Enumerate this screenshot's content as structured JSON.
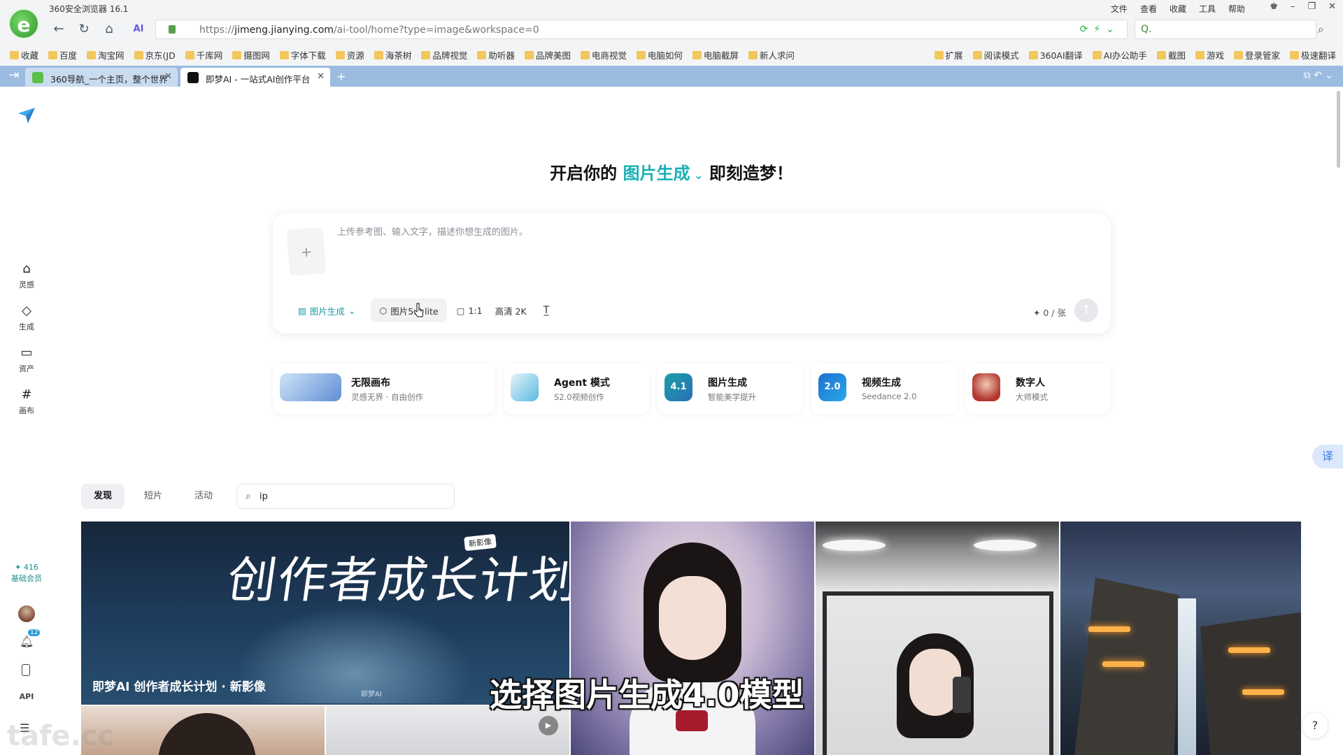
{
  "browser": {
    "window_title": "360安全浏览器 16.1",
    "menu": [
      "文件",
      "查看",
      "收藏",
      "工具",
      "帮助"
    ],
    "url_prefix": "https://",
    "url_host": "jimeng.jianying.com",
    "url_path": "/ai-tool/home?type=image&workspace=0",
    "search_value": "Q.",
    "bookmarks_left": [
      "收藏",
      "百度",
      "淘宝网",
      "京东(JD",
      "千库网",
      "摄图网",
      "字体下载",
      "资源",
      "海茶树",
      "品牌视觉",
      "助听器",
      "品牌美图",
      "电商视觉",
      "电脑如何",
      "电脑截屏",
      "新人求问"
    ],
    "bookmarks_right": [
      "扩展",
      "阅读模式",
      "360AI翻译",
      "AI办公助手",
      "截图",
      "游戏",
      "登录管家",
      "极速翻译"
    ],
    "tabs": [
      {
        "label": "360导航_一个主页，整个世界"
      },
      {
        "label": "即梦AI - 一站式AI创作平台"
      }
    ]
  },
  "rail": {
    "items": [
      {
        "label": "灵感",
        "icon": "home-icon"
      },
      {
        "label": "生成",
        "icon": "generate-icon"
      },
      {
        "label": "资产",
        "icon": "folder-icon"
      },
      {
        "label": "画布",
        "icon": "canvas-icon"
      }
    ],
    "credits": "✦ 416",
    "member": "基础会员",
    "notif_count": "12",
    "api": "API"
  },
  "hero": {
    "prefix": "开启你的",
    "accent": "图片生成",
    "suffix": "即刻造梦！"
  },
  "prompt": {
    "placeholder": "上传参考图、输入文字，描述你想生成的图片。",
    "mode": "图片生成",
    "model": "图片5.0 lite",
    "ratio": "1:1",
    "quality": "高清 2K",
    "cost": "✦ 0 / 张"
  },
  "features": [
    {
      "title": "无限画布",
      "sub": "灵感无界 · 自由创作"
    },
    {
      "title": "Agent 模式",
      "sub": "S2.0视频创作"
    },
    {
      "title": "图片生成",
      "sub": "智能美学提升",
      "badge": "4.1"
    },
    {
      "title": "视频生成",
      "sub": "Seedance 2.0",
      "badge": "2.0"
    },
    {
      "title": "数字人",
      "sub": "大师模式"
    }
  ],
  "discover": {
    "tabs": [
      "发现",
      "短片",
      "活动"
    ],
    "search_value": "ip"
  },
  "gallery": {
    "banner_big": "创作者成长计划",
    "banner_tag": "新影像",
    "banner_caption": "即梦AI 创作者成长计划 · 新影像",
    "banner_logo": "即梦AI"
  },
  "overlay": {
    "subtitle": "选择图片生成4.0模型",
    "watermark": "tafe.cc"
  },
  "colors": {
    "accent": "#1ab0b6",
    "tabbar": "#9bbce0"
  }
}
